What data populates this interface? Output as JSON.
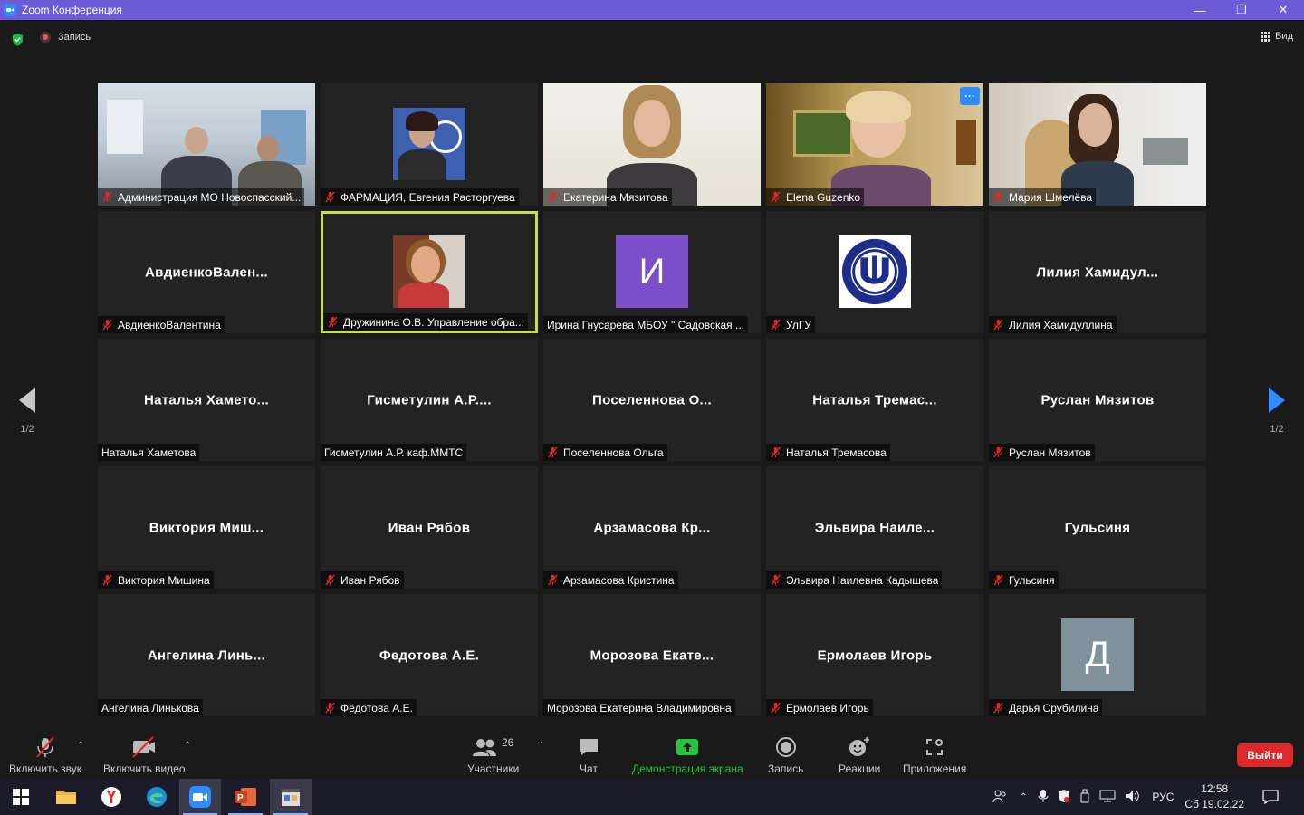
{
  "window": {
    "title": "Zoom Конференция",
    "controls": [
      "minimize-icon",
      "restore-icon",
      "close-icon"
    ]
  },
  "topbar": {
    "recording_label": "Запись",
    "view_label": "Вид"
  },
  "pagination": {
    "left": "1/2",
    "right": "1/2"
  },
  "participants": [
    {
      "display": "video",
      "label": "Администрация МО Новоспасский...",
      "muted": true
    },
    {
      "display": "video",
      "label": "ФАРМАЦИЯ, Евгения Расторгуева",
      "muted": true
    },
    {
      "display": "video",
      "label": "Екатерина Мязитова",
      "muted": true
    },
    {
      "display": "video",
      "label": "Elena Guzenko",
      "muted": true,
      "more": "···"
    },
    {
      "display": "video",
      "label": "Мария Шмелёва",
      "muted": true
    },
    {
      "display": "name",
      "big": "АвдиенкоВален...",
      "label": "АвдиенкоВалентина",
      "muted": true
    },
    {
      "display": "video",
      "label": "Дружинина О.В. Управление обра...",
      "muted": true,
      "active": true
    },
    {
      "display": "avatar",
      "avatar_letter": "И",
      "avatar_color": "#7b4fc9",
      "label": "Ирина Гнусарева МБОУ \" Садовская ...",
      "muted": false
    },
    {
      "display": "logo",
      "label": "УлГУ",
      "muted": true
    },
    {
      "display": "name",
      "big": "Лилия  Хамидул...",
      "label": "Лилия Хамидуллина",
      "muted": true
    },
    {
      "display": "name",
      "big": "Наталья  Хамето...",
      "label": "Наталья Хаметова",
      "muted": false
    },
    {
      "display": "name",
      "big": "Гисметулин  А.Р....",
      "label": "Гисметулин А.Р. каф.ММТС",
      "muted": false
    },
    {
      "display": "name",
      "big": "Поселеннова  О...",
      "label": "Поселеннова Ольга",
      "muted": true
    },
    {
      "display": "name",
      "big": "Наталья  Тремас...",
      "label": "Наталья Тремасова",
      "muted": true
    },
    {
      "display": "name",
      "big": "Руслан Мязитов",
      "label": "Руслан Мязитов",
      "muted": true
    },
    {
      "display": "name",
      "big": "Виктория  Миш...",
      "label": "Виктория Мишина",
      "muted": true
    },
    {
      "display": "name",
      "big": "Иван Рябов",
      "label": "Иван Рябов",
      "muted": true
    },
    {
      "display": "name",
      "big": "Арзамасова  Кр...",
      "label": "Арзамасова Кристина",
      "muted": true
    },
    {
      "display": "name",
      "big": "Эльвира  Наиле...",
      "label": "Эльвира Наилевна Кадышева",
      "muted": true
    },
    {
      "display": "name",
      "big": "Гульсиня",
      "label": "Гульсиня",
      "muted": true
    },
    {
      "display": "name",
      "big": "Ангелина  Линь...",
      "label": "Ангелина Линькова",
      "muted": false
    },
    {
      "display": "name",
      "big": "Федотова А.Е.",
      "label": "Федотова А.Е.",
      "muted": true
    },
    {
      "display": "name",
      "big": "Морозова  Екате...",
      "label": "Морозова Екатерина Владимировна",
      "muted": false
    },
    {
      "display": "name",
      "big": "Ермолаев Игорь",
      "label": "Ермолаев Игорь",
      "muted": true
    },
    {
      "display": "avatar",
      "avatar_letter": "Д",
      "avatar_color": "#7f929c",
      "label": "Дарья Срубилина",
      "muted": true
    }
  ],
  "toolbar": {
    "audio_label": "Включить звук",
    "video_label": "Включить видео",
    "participants_label": "Участники",
    "participants_count": "26",
    "chat_label": "Чат",
    "share_label": "Демонстрация экрана",
    "record_label": "Запись",
    "reactions_label": "Реакции",
    "apps_label": "Приложения",
    "leave_label": "Выйти",
    "share_color": "#25c43d",
    "leave_color": "#e02828"
  },
  "taskbar": {
    "apps": [
      "windows-start-icon",
      "file-explorer-icon",
      "yandex-browser-icon",
      "edge-icon",
      "zoom-icon",
      "powerpoint-icon",
      "movie-maker-icon"
    ],
    "language": "РУС",
    "time": "12:58",
    "date": "Сб 19.02.22"
  }
}
